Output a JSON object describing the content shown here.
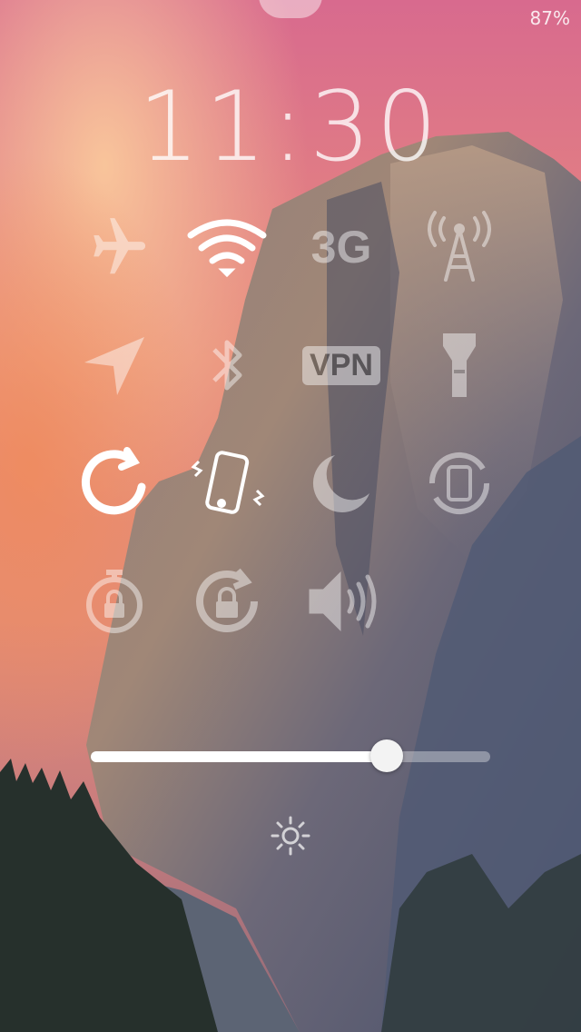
{
  "status": {
    "battery": "87%"
  },
  "clock": {
    "time": "11:30"
  },
  "toggles": [
    {
      "name": "airplane-mode",
      "icon": "airplane-icon",
      "state": "off"
    },
    {
      "name": "wifi",
      "icon": "wifi-icon",
      "state": "on"
    },
    {
      "name": "cellular-3g",
      "icon": "3g-icon",
      "label": "3G",
      "state": "off"
    },
    {
      "name": "cellular-data",
      "icon": "antenna-icon",
      "state": "off"
    },
    {
      "name": "location",
      "icon": "location-arrow-icon",
      "state": "off"
    },
    {
      "name": "bluetooth",
      "icon": "bluetooth-icon",
      "state": "off"
    },
    {
      "name": "vpn",
      "icon": "vpn-icon",
      "label": "VPN",
      "state": "off"
    },
    {
      "name": "flashlight",
      "icon": "flashlight-icon",
      "state": "off"
    },
    {
      "name": "respring",
      "icon": "refresh-icon",
      "state": "on"
    },
    {
      "name": "vibration",
      "icon": "vibrating-phone-icon",
      "state": "on"
    },
    {
      "name": "do-not-disturb",
      "icon": "moon-icon",
      "state": "off"
    },
    {
      "name": "rotation-phone",
      "icon": "rotate-phone-icon",
      "state": "off"
    },
    {
      "name": "auto-lock",
      "icon": "stopwatch-lock-icon",
      "state": "off"
    },
    {
      "name": "rotation-lock",
      "icon": "rotation-lock-icon",
      "state": "off"
    },
    {
      "name": "ringer",
      "icon": "speaker-icon",
      "state": "off"
    }
  ],
  "brightness": {
    "level": 0.74,
    "icon": "sun-icon"
  },
  "colors": {
    "icon": "#ffffff",
    "sky_top": "#d46a8c",
    "sky_mid": "#e9907a",
    "rock": "#6d6a72"
  }
}
